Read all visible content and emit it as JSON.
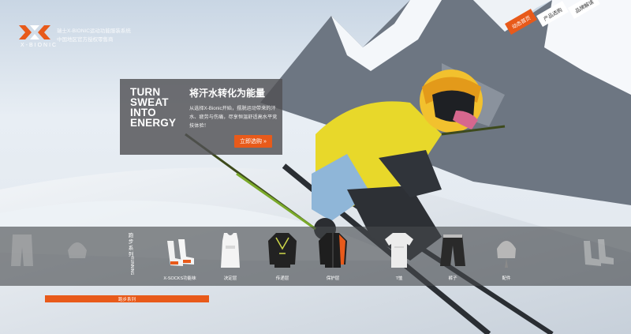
{
  "brand": {
    "logo_text": "X-BIONIC",
    "tagline_line1": "瑞士X-BIONIC运动功能服装系统",
    "tagline_line2": "中国地区官方授权零售商"
  },
  "nav": {
    "home": "动态首页",
    "products": "产品选购",
    "brand": "品牌解读"
  },
  "promo": {
    "english_title_lines": [
      "TURN",
      "SWEAT",
      "INTO",
      "ENERGY"
    ],
    "english_title": "TURN SWEAT INTO ENERGY",
    "chinese_title": "将汗水转化为能量",
    "description": "从选择X-Bionic开始，摆脱运动带来的汗水、疲劳与伤痛，尽享恒温舒适高水平竞技体验！",
    "button_label": "立即选购 »"
  },
  "series": {
    "label": "跑步系列",
    "sub_label": "RUNNING"
  },
  "products": [
    {
      "label": "X-SOCKS功能袜",
      "icon": "socks-icon"
    },
    {
      "label": "决定层",
      "icon": "vest-icon"
    },
    {
      "label": "传递层",
      "icon": "long-sleeve-shirt-icon"
    },
    {
      "label": "保护层",
      "icon": "jacket-icon"
    },
    {
      "label": "T恤",
      "icon": "tshirt-icon"
    },
    {
      "label": "裤子",
      "icon": "shorts-icon"
    },
    {
      "label": "配件",
      "icon": "cap-icon"
    }
  ],
  "tab": {
    "label": "跑步系列"
  },
  "colors": {
    "accent": "#e85a1a",
    "panel": "#505054",
    "jacket_yellow": "#e8d82a",
    "jacket_blue": "#8fb6d8"
  }
}
